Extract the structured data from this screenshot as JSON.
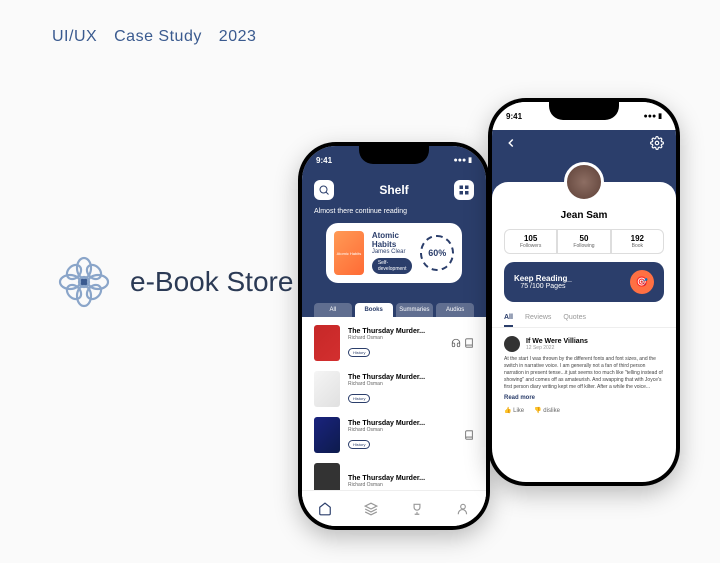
{
  "header": {
    "label1": "UI/UX",
    "label2": "Case Study",
    "year": "2023"
  },
  "brand": {
    "name": "e-Book Store"
  },
  "statusTime": "9:41",
  "phone1": {
    "title": "Shelf",
    "subtitle": "Almost there continue reading",
    "currentBook": {
      "title": "Atomic Habits",
      "author": "James Clear",
      "tag": "Self-development",
      "progress": "60%"
    },
    "tabs": {
      "all": "All",
      "books": "Books",
      "summaries": "Summaries",
      "audios": "Audios"
    },
    "list": {
      "title": "The Thursday Murder...",
      "author": "Richard Osman",
      "tag": "History"
    }
  },
  "phone2": {
    "name": "Jean Sam",
    "stats": {
      "followers": "105",
      "followersLbl": "Followers",
      "following": "50",
      "followingLbl": "Following",
      "books": "192",
      "booksLbl": "Book"
    },
    "goal": {
      "title": "Keep Reading_",
      "pages": "75 /100 Pages"
    },
    "tabs": {
      "all": "All",
      "reviews": "Reviews",
      "quotes": "Quotes"
    },
    "review": {
      "title": "If We Were Villians",
      "date": "12 Sep 2022",
      "text": "At the start I was thrown by the different fonts and font sizes, and the switch in narrative voice. I am generally not a fan of third person narration in present tense...it just seems too much like \"telling instead of showing\" and comes off as amateurish. And swapping that with Joyce's first person diary writing kept me off kilter. After a while the voice...",
      "readMore": "Read more",
      "like": "Like",
      "dislike": "dislike"
    }
  }
}
